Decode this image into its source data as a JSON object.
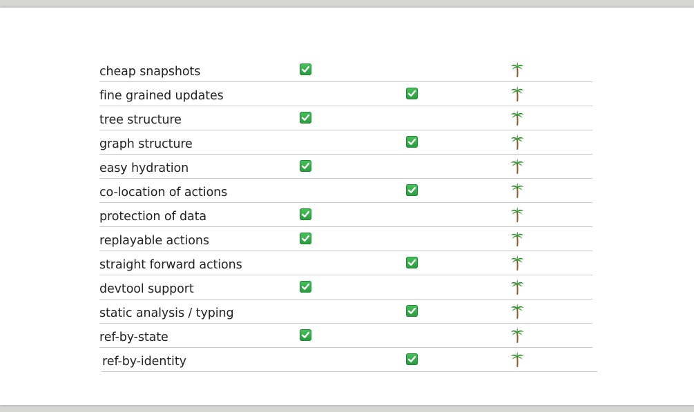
{
  "rows": [
    {
      "label": "cheap snapshots",
      "col_a": true,
      "col_b": false,
      "palm": true
    },
    {
      "label": "fine grained updates",
      "col_a": false,
      "col_b": true,
      "palm": true
    },
    {
      "label": "tree structure",
      "col_a": true,
      "col_b": false,
      "palm": true
    },
    {
      "label": "graph structure",
      "col_a": false,
      "col_b": true,
      "palm": true
    },
    {
      "label": "easy hydration",
      "col_a": true,
      "col_b": false,
      "palm": true
    },
    {
      "label": "co-location of actions",
      "col_a": false,
      "col_b": true,
      "palm": true
    },
    {
      "label": "protection of data",
      "col_a": true,
      "col_b": false,
      "palm": true
    },
    {
      "label": "replayable actions",
      "col_a": true,
      "col_b": false,
      "palm": true
    },
    {
      "label": "straight forward actions",
      "col_a": false,
      "col_b": true,
      "palm": true
    },
    {
      "label": "devtool support",
      "col_a": true,
      "col_b": false,
      "palm": true
    },
    {
      "label": "static analysis / typing",
      "col_a": false,
      "col_b": true,
      "palm": true
    },
    {
      "label": "ref-by-state",
      "col_a": true,
      "col_b": false,
      "palm": true
    },
    {
      "label": "ref-by-identity",
      "col_a": false,
      "col_b": true,
      "palm": true
    }
  ],
  "icons": {
    "check": "white-heavy-check-mark-icon",
    "palm": "palm-tree-icon"
  },
  "colors": {
    "check_green": "#2ea44f",
    "palm_green": "#2f8a2a",
    "palm_trunk": "#8b5a2b",
    "row_border": "#c8c8c8",
    "background": "#d6d6d4"
  }
}
